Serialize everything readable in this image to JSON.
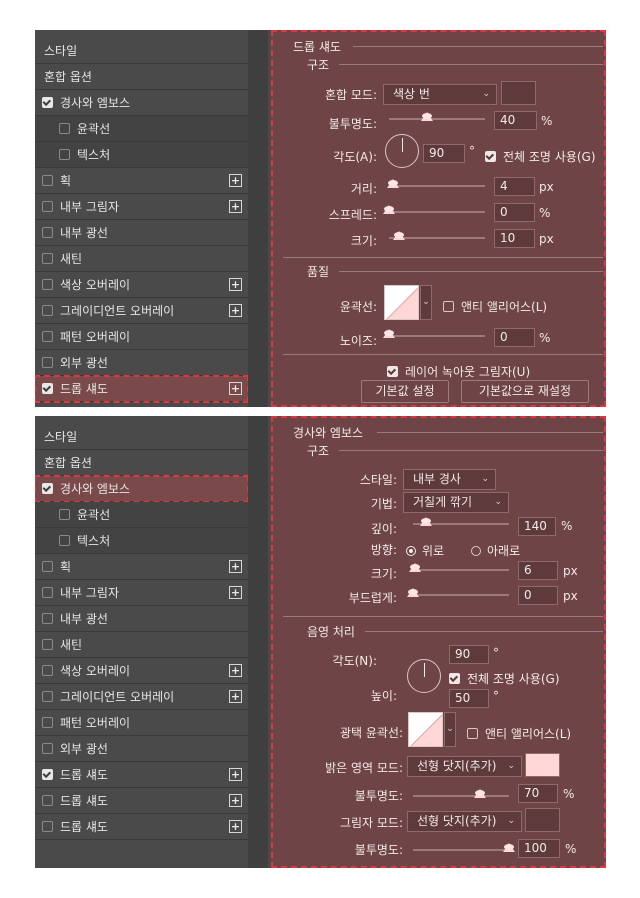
{
  "screen1": {
    "sidebar": [
      {
        "label": "스타일",
        "kind": "plain"
      },
      {
        "label": "혼합 옵션",
        "kind": "plain"
      },
      {
        "label": "경사와 엠보스",
        "kind": "check",
        "checked": true,
        "plus": false
      },
      {
        "label": "윤곽선",
        "kind": "sub",
        "checked": false
      },
      {
        "label": "텍스처",
        "kind": "sub",
        "checked": false
      },
      {
        "label": "획",
        "kind": "check",
        "checked": false,
        "plus": true
      },
      {
        "label": "내부 그림자",
        "kind": "check",
        "checked": false,
        "plus": true
      },
      {
        "label": "내부 광선",
        "kind": "check",
        "checked": false,
        "plus": false
      },
      {
        "label": "새틴",
        "kind": "check",
        "checked": false,
        "plus": false
      },
      {
        "label": "색상 오버레이",
        "kind": "check",
        "checked": false,
        "plus": true
      },
      {
        "label": "그레이디언트 오버레이",
        "kind": "check",
        "checked": false,
        "plus": true
      },
      {
        "label": "패턴 오버레이",
        "kind": "check",
        "checked": false,
        "plus": false
      },
      {
        "label": "외부 광선",
        "kind": "check",
        "checked": false,
        "plus": false
      },
      {
        "label": "드롭 섀도",
        "kind": "check",
        "checked": true,
        "plus": true,
        "selected": true
      }
    ],
    "panel": {
      "title": "드롭 섀도",
      "structure_title": "구조",
      "blend_mode_label": "혼합 모드:",
      "blend_mode_value": "색상 번",
      "blend_color": "#5e3a3c",
      "opacity_label": "불투명도:",
      "opacity_value": "40",
      "opacity_level": 40,
      "percent": "%",
      "angle_label": "각도(A):",
      "angle_value": "90",
      "degree": "°",
      "global_light_label": "전체 조명 사용(G)",
      "global_light_checked": true,
      "distance_label": "거리:",
      "distance_value": "4",
      "distance_level": 4,
      "px": "px",
      "spread_label": "스프레드:",
      "spread_value": "0",
      "spread_level": 0,
      "size_label": "크기:",
      "size_value": "10",
      "size_level": 10,
      "quality_title": "품질",
      "contour_label": "윤곽선:",
      "antialias_label": "앤티 앨리어스(L)",
      "antialias_checked": false,
      "noise_label": "노이즈:",
      "noise_value": "0",
      "noise_level": 0,
      "knockout_label": "레이어 녹아웃 그림자(U)",
      "knockout_checked": true,
      "make_default": "기본값 설정",
      "reset_default": "기본값으로 재설정"
    }
  },
  "screen2": {
    "sidebar": [
      {
        "label": "스타일",
        "kind": "plain"
      },
      {
        "label": "혼합 옵션",
        "kind": "plain"
      },
      {
        "label": "경사와 엠보스",
        "kind": "check",
        "checked": true,
        "plus": false,
        "selected": true
      },
      {
        "label": "윤곽선",
        "kind": "sub",
        "checked": false
      },
      {
        "label": "텍스처",
        "kind": "sub",
        "checked": false
      },
      {
        "label": "획",
        "kind": "check",
        "checked": false,
        "plus": true
      },
      {
        "label": "내부 그림자",
        "kind": "check",
        "checked": false,
        "plus": true
      },
      {
        "label": "내부 광선",
        "kind": "check",
        "checked": false,
        "plus": false
      },
      {
        "label": "새틴",
        "kind": "check",
        "checked": false,
        "plus": false
      },
      {
        "label": "색상 오버레이",
        "kind": "check",
        "checked": false,
        "plus": true
      },
      {
        "label": "그레이디언트 오버레이",
        "kind": "check",
        "checked": false,
        "plus": true
      },
      {
        "label": "패턴 오버레이",
        "kind": "check",
        "checked": false,
        "plus": false
      },
      {
        "label": "외부 광선",
        "kind": "check",
        "checked": false,
        "plus": false
      },
      {
        "label": "드롭 섀도",
        "kind": "check",
        "checked": true,
        "plus": true
      },
      {
        "label": "드롭 섀도",
        "kind": "check",
        "checked": false,
        "plus": true
      },
      {
        "label": "드롭 섀도",
        "kind": "check",
        "checked": false,
        "plus": true
      }
    ],
    "panel": {
      "title": "경사와 엠보스",
      "structure_title": "구조",
      "style_label": "스타일:",
      "style_value": "내부 경사",
      "technique_label": "기법:",
      "technique_value": "거칠게 깎기",
      "depth_label": "깊이:",
      "depth_value": "140",
      "depth_level": 140,
      "percent": "%",
      "direction_label": "방향:",
      "direction_up": "위로",
      "direction_down": "아래로",
      "size_label": "크기:",
      "size_value": "6",
      "size_level": 6,
      "px": "px",
      "soften_label": "부드럽게:",
      "soften_value": "0",
      "soften_level": 0,
      "shading_title": "음영 처리",
      "angle_label": "각도(N):",
      "angle_value": "90",
      "degree": "°",
      "global_light_label": "전체 조명 사용(G)",
      "global_light_checked": true,
      "altitude_label": "높이:",
      "altitude_value": "50",
      "gloss_label": "광택 윤곽선:",
      "antialias_label": "앤티 앨리어스(L)",
      "antialias_checked": false,
      "highlight_label": "밝은 영역 모드:",
      "highlight_value": "선형 닷지(추가)",
      "highlight_color": "#ffd7d7",
      "hl_opacity_label": "불투명도:",
      "hl_opacity_value": "70",
      "hl_opacity_level": 70,
      "shadow_label": "그림자 모드:",
      "shadow_value": "선형 닷지(추가)",
      "shadow_color": "#5e3a3c",
      "sh_opacity_label": "불투명도:",
      "sh_opacity_value": "100",
      "sh_opacity_level": 100
    }
  }
}
